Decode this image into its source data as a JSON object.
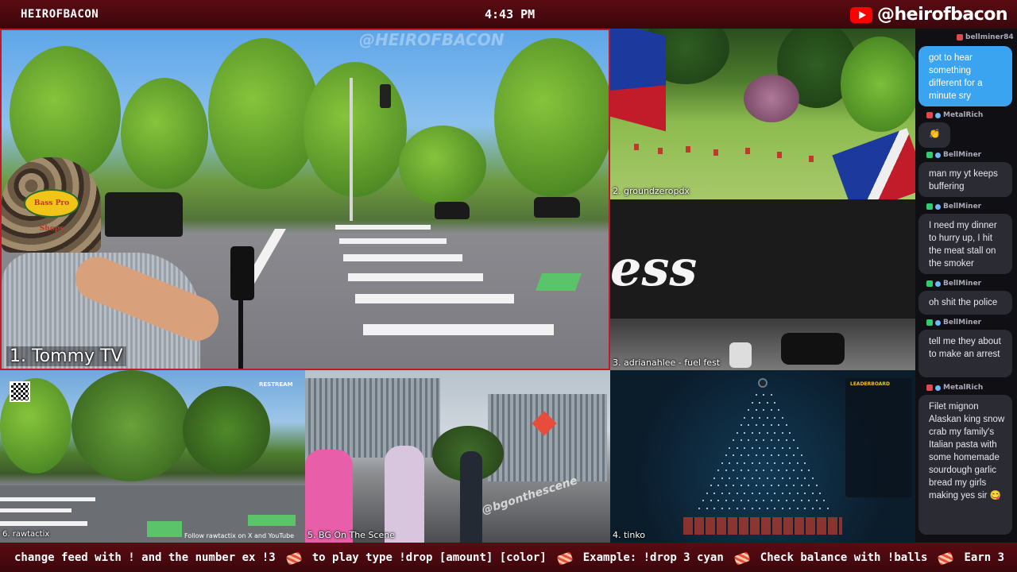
{
  "header": {
    "brand": "HEIROFBACON",
    "time": "4:43 PM",
    "youtube_handle": "@heirofbacon"
  },
  "feeds": [
    {
      "label": "1. Tommy TV",
      "watermark": "@HEIROFBACON",
      "hat_text": "Bass Pro Shops"
    },
    {
      "label": "2. groundzeropdx"
    },
    {
      "label": "3. adrianahlee - fuel fest",
      "overlay_text": "ess"
    },
    {
      "label": "4. tinko",
      "leaderboard_title": "LEADERBOARD"
    },
    {
      "label": "5. BG On The Scene",
      "watermark": "@bgonthescene"
    },
    {
      "label": "6. rawtactix",
      "restream": "RESTREAM",
      "follow_text": "Follow rawtactix on X and YouTube"
    }
  ],
  "chat": [
    {
      "user": "bellminer84",
      "text": "got to hear something different for a minute sry",
      "self": true
    },
    {
      "user": "MetalRich",
      "text": "👏",
      "badge": "#e0484e"
    },
    {
      "user": "BellMiner",
      "text": "man my yt keeps buffering",
      "badge": "#2ecc71"
    },
    {
      "user": "BellMiner",
      "text": "I need my dinner to hurry up, I hit the meat stall on the smoker",
      "badge": "#2ecc71"
    },
    {
      "user": "BellMiner",
      "text": "oh shit the police",
      "badge": "#2ecc71"
    },
    {
      "user": "BellMiner",
      "text": "tell me they about to make an arrest",
      "badge": "#2ecc71"
    },
    {
      "user": "MetalRich",
      "text": "Filet mignon Alaskan king snow crab my family's Italian pasta with some homemade sourdough garlic bread my girls making yes sir 😋",
      "badge": "#e0484e"
    }
  ],
  "ticker": {
    "items": [
      "change feed with ! and the number ex !3",
      "to play type !drop [amount] [color]",
      "Example: !drop 3 cyan",
      "Check balance with !balls",
      "Earn 3"
    ]
  },
  "colors": {
    "accent": "#c01a2a",
    "bar": "#4a0a10",
    "chat_self": "#3aa4f0"
  }
}
